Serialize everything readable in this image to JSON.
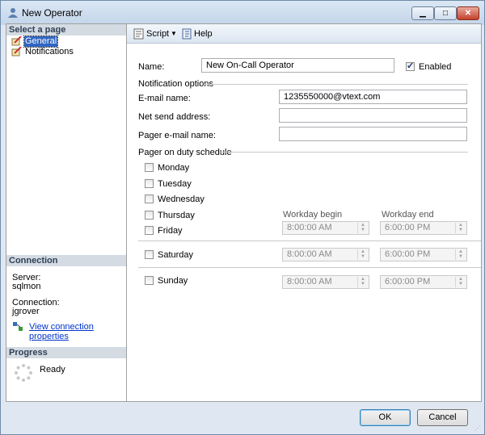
{
  "window": {
    "title": "New Operator"
  },
  "left_pane": {
    "select_page_header": "Select a page",
    "pages": [
      {
        "label": "General"
      },
      {
        "label": "Notifications"
      }
    ],
    "connection_header": "Connection",
    "server_label": "Server:",
    "server_value": "sqlmon",
    "connection_label": "Connection:",
    "connection_value": "jgrover",
    "view_connection_link": "View connection properties",
    "progress_header": "Progress",
    "progress_status": "Ready"
  },
  "toolbar": {
    "script_label": "Script",
    "help_label": "Help"
  },
  "form": {
    "name_label": "Name:",
    "name_value": "New On-Call Operator",
    "enabled_label": "Enabled",
    "enabled_checked": true,
    "notification_options_header": "Notification options",
    "email_label": "E-mail name:",
    "email_value": "1235550000@vtext.com",
    "net_send_label": "Net send address:",
    "net_send_value": "",
    "pager_email_label": "Pager e-mail name:",
    "pager_email_value": "",
    "pager_schedule_header": "Pager on duty schedule",
    "days": [
      {
        "label": "Monday",
        "checked": false
      },
      {
        "label": "Tuesday",
        "checked": false
      },
      {
        "label": "Wednesday",
        "checked": false
      },
      {
        "label": "Thursday",
        "checked": false
      },
      {
        "label": "Friday",
        "checked": false
      }
    ],
    "workday_begin_header": "Workday begin",
    "workday_end_header": "Workday end",
    "weekday_begin": "8:00:00 AM",
    "weekday_end": "6:00:00 PM",
    "saturday": {
      "label": "Saturday",
      "checked": false,
      "begin": "8:00:00 AM",
      "end": "6:00:00 PM"
    },
    "sunday": {
      "label": "Sunday",
      "checked": false,
      "begin": "8:00:00 AM",
      "end": "6:00:00 PM"
    }
  },
  "buttons": {
    "ok": "OK",
    "cancel": "Cancel"
  }
}
